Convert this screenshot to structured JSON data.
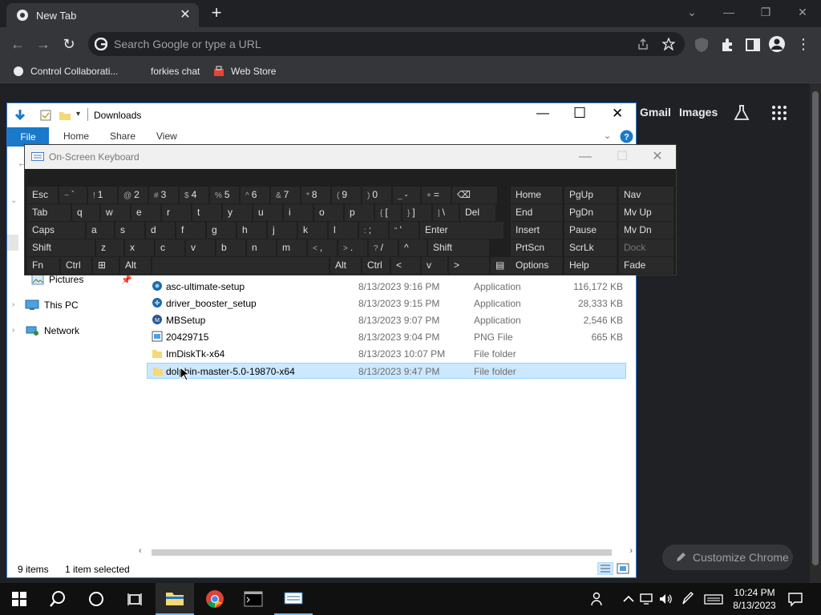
{
  "chrome": {
    "tab_title": "New Tab",
    "omnibox_placeholder": "Search Google or type a URL",
    "bookmarks": [
      "Control Collaborati...",
      "forkies chat",
      "Web Store"
    ],
    "ntp_links": [
      "Gmail",
      "Images"
    ],
    "customize_label": "Customize Chrome"
  },
  "explorer": {
    "title": "Downloads",
    "ribbon_tabs": [
      "File",
      "Home",
      "Share",
      "View"
    ],
    "nav_items": [
      "Pictures",
      "This PC",
      "Network"
    ],
    "files": [
      {
        "name": "asc-ultimate-setup",
        "date": "8/13/2023 9:16 PM",
        "type": "Application",
        "size": "116,172 KB"
      },
      {
        "name": "driver_booster_setup",
        "date": "8/13/2023 9:15 PM",
        "type": "Application",
        "size": "28,333 KB"
      },
      {
        "name": "MBSetup",
        "date": "8/13/2023 9:07 PM",
        "type": "Application",
        "size": "2,546 KB"
      },
      {
        "name": "20429715",
        "date": "8/13/2023 9:04 PM",
        "type": "PNG File",
        "size": "665 KB"
      },
      {
        "name": "ImDiskTk-x64",
        "date": "8/13/2023 10:07 PM",
        "type": "File folder",
        "size": ""
      },
      {
        "name": "dolphin-master-5.0-19870-x64",
        "date": "8/13/2023 9:47 PM",
        "type": "File folder",
        "size": ""
      }
    ],
    "status_items": "9 items",
    "status_selected": "1 item selected"
  },
  "osk": {
    "title": "On-Screen Keyboard",
    "row1": [
      {
        "main": "Esc"
      },
      {
        "sub": "~",
        "main": "`"
      },
      {
        "sub": "!",
        "main": "1"
      },
      {
        "sub": "@",
        "main": "2"
      },
      {
        "sub": "#",
        "main": "3"
      },
      {
        "sub": "$",
        "main": "4"
      },
      {
        "sub": "%",
        "main": "5"
      },
      {
        "sub": "^",
        "main": "6"
      },
      {
        "sub": "&",
        "main": "7"
      },
      {
        "sub": "*",
        "main": "8"
      },
      {
        "sub": "(",
        "main": "9"
      },
      {
        "sub": ")",
        "main": "0"
      },
      {
        "sub": "_",
        "main": "-"
      },
      {
        "sub": "+",
        "main": "="
      },
      {
        "main": "⌫"
      }
    ],
    "row2": [
      {
        "main": "Tab"
      },
      {
        "main": "q"
      },
      {
        "main": "w"
      },
      {
        "main": "e"
      },
      {
        "main": "r"
      },
      {
        "main": "t"
      },
      {
        "main": "y"
      },
      {
        "main": "u"
      },
      {
        "main": "i"
      },
      {
        "main": "o"
      },
      {
        "main": "p"
      },
      {
        "sub": "{",
        "main": "["
      },
      {
        "sub": "}",
        "main": "]"
      },
      {
        "sub": "|",
        "main": "\\"
      },
      {
        "main": "Del"
      }
    ],
    "row3": [
      {
        "main": "Caps"
      },
      {
        "main": "a"
      },
      {
        "main": "s"
      },
      {
        "main": "d"
      },
      {
        "main": "f"
      },
      {
        "main": "g"
      },
      {
        "main": "h"
      },
      {
        "main": "j"
      },
      {
        "main": "k"
      },
      {
        "main": "l"
      },
      {
        "sub": ":",
        "main": ";"
      },
      {
        "sub": "\"",
        "main": "'"
      },
      {
        "main": "Enter"
      }
    ],
    "row4": [
      {
        "main": "Shift"
      },
      {
        "main": "z"
      },
      {
        "main": "x"
      },
      {
        "main": "c"
      },
      {
        "main": "v"
      },
      {
        "main": "b"
      },
      {
        "main": "n"
      },
      {
        "main": "m"
      },
      {
        "sub": "<",
        "main": ","
      },
      {
        "sub": ">",
        "main": "."
      },
      {
        "sub": "?",
        "main": "/"
      },
      {
        "main": "^"
      },
      {
        "main": "Shift"
      }
    ],
    "row5": [
      {
        "main": "Fn"
      },
      {
        "main": "Ctrl"
      },
      {
        "main": "⊞"
      },
      {
        "main": "Alt"
      },
      {
        "main": ""
      },
      {
        "main": "Alt"
      },
      {
        "main": "Ctrl"
      },
      {
        "main": "<"
      },
      {
        "main": "v"
      },
      {
        "main": ">"
      },
      {
        "main": "▤"
      }
    ],
    "side": [
      [
        "Home",
        "PgUp",
        "Nav"
      ],
      [
        "End",
        "PgDn",
        "Mv Up"
      ],
      [
        "Insert",
        "Pause",
        "Mv Dn"
      ],
      [
        "PrtScn",
        "ScrLk",
        "Dock"
      ],
      [
        "Options",
        "Help",
        "Fade"
      ]
    ]
  },
  "taskbar": {
    "time": "10:24 PM",
    "date": "8/13/2023"
  },
  "colors": {
    "accent": "#1979ca",
    "selection": "#cce8ff"
  }
}
